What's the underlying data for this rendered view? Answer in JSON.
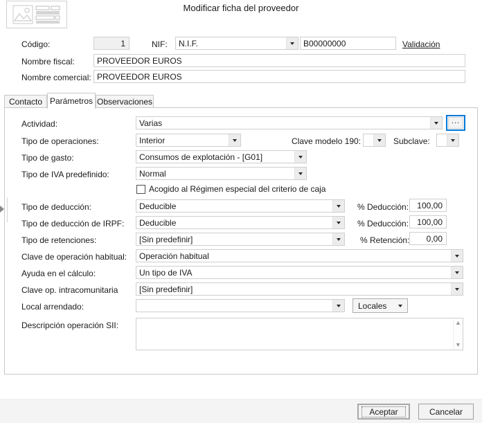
{
  "dialog": {
    "title": "Modificar ficha del proveedor",
    "icon": "record-card-icon"
  },
  "header_form": {
    "codigo": {
      "label": "Código:",
      "value": "1"
    },
    "nif": {
      "label": "NIF:",
      "type_value": "N.I.F.",
      "number_value": "B00000000",
      "validation_link": "Validación"
    },
    "nombre_fiscal": {
      "label": "Nombre fiscal:",
      "value": "PROVEEDOR EUROS"
    },
    "nombre_comercial": {
      "label": "Nombre comercial:",
      "value": "PROVEEDOR EUROS"
    }
  },
  "tabs": [
    {
      "label": "Contacto",
      "active": false
    },
    {
      "label": "Parámetros",
      "active": true
    },
    {
      "label": "Observaciones",
      "active": false
    }
  ],
  "parametros": {
    "actividad": {
      "label": "Actividad:",
      "value": "Varias",
      "browse_button": "..."
    },
    "tipo_operaciones": {
      "label": "Tipo de operaciones:",
      "value": "Interior"
    },
    "clave_modelo_190": {
      "label": "Clave modelo 190:",
      "value": ""
    },
    "subclave": {
      "label": "Subclave:",
      "value": ""
    },
    "tipo_gasto": {
      "label": "Tipo de gasto:",
      "value": "Consumos de explotación - [G01]"
    },
    "tipo_iva_predefinido": {
      "label": "Tipo de IVA predefinido:",
      "value": "Normal"
    },
    "regimen_criterio_caja": {
      "label": "Acogido al Régimen especial del criterio de caja",
      "checked": false
    },
    "tipo_deduccion": {
      "label": "Tipo de deducción:",
      "value": "Deducible"
    },
    "pct_deduccion": {
      "label": "% Deducción:",
      "value": "100,00"
    },
    "tipo_deduccion_irpf": {
      "label": "Tipo de deducción de IRPF:",
      "value": "Deducible"
    },
    "pct_deduccion_irpf": {
      "label": "% Deducción:",
      "value": "100,00"
    },
    "tipo_retenciones": {
      "label": "Tipo de retenciones:",
      "value": "[Sin predefinir]"
    },
    "pct_retencion": {
      "label": "% Retención:",
      "value": "0,00"
    },
    "clave_operacion_habitual": {
      "label": "Clave de operación habitual:",
      "value": "Operación habitual"
    },
    "ayuda_calculo": {
      "label": "Ayuda en el cálculo:",
      "value": "Un tipo de IVA"
    },
    "clave_op_intracomunitaria": {
      "label": "Clave op. intracomunitaria",
      "value": "[Sin predefinir]"
    },
    "local_arrendado": {
      "label": "Local arrendado:",
      "value": "",
      "unit_value": "Locales"
    },
    "descripcion_sii": {
      "label": "Descripción operación SII:",
      "value": ""
    }
  },
  "footer": {
    "accept": "Aceptar",
    "cancel": "Cancelar"
  },
  "colors": {
    "focus_ring": "#0078D7",
    "panel_border": "#C8C8C8",
    "field_border": "#CFCFCF",
    "footer_bg": "#F4F4F4"
  }
}
